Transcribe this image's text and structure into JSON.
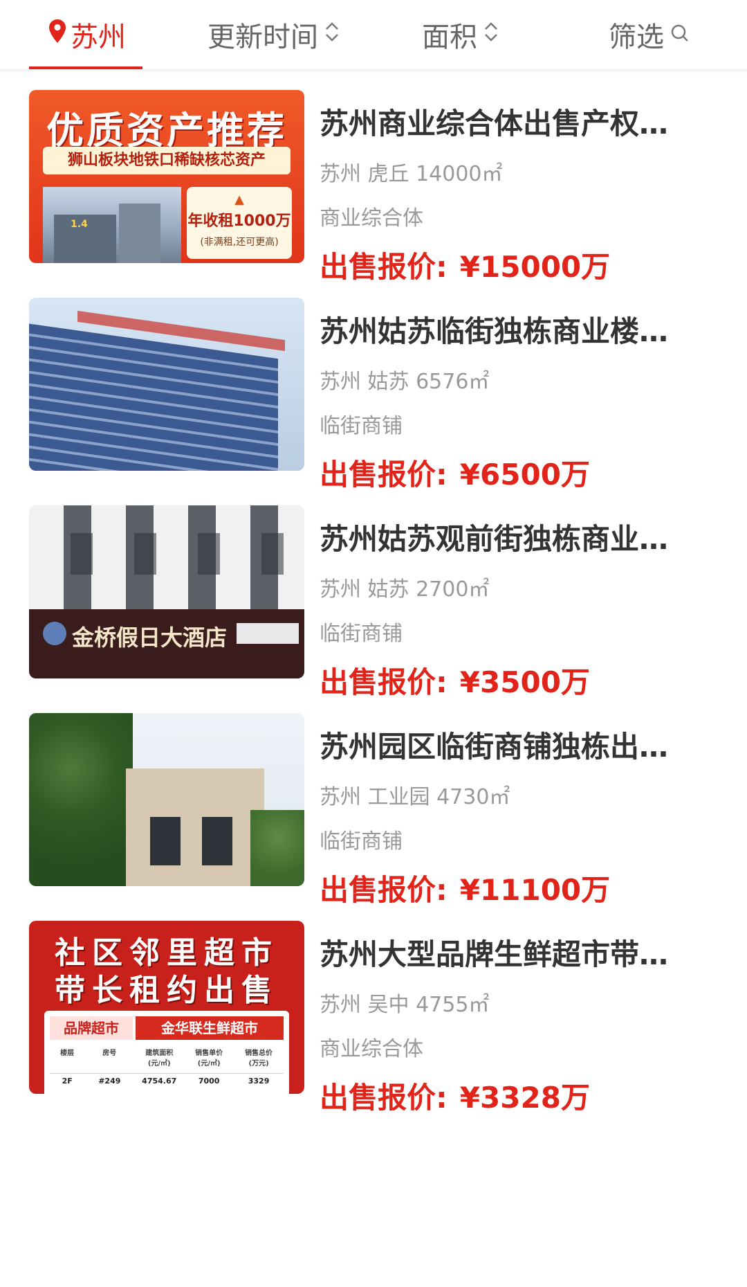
{
  "filter_bar": {
    "city": "苏州",
    "sort_updated": "更新时间",
    "sort_area": "面积",
    "filter": "筛选"
  },
  "colors": {
    "accent": "#e22319",
    "text_primary": "#333333",
    "text_secondary": "#999999"
  },
  "icons": {
    "city": "location-pin-icon",
    "sort": "sort-updown-icon",
    "filter": "search-icon"
  },
  "listings": [
    {
      "title": "苏州商业综合体出售产权…",
      "meta": "苏州 虎丘 14000㎡",
      "type": "商业综合体",
      "price_label": "出售报价:",
      "price_value": "¥15000万",
      "thumb": {
        "headline": "优质资产推荐",
        "subline": "狮山板块地铁口稀缺核芯资产",
        "tag": "1.4",
        "rent_title": "年收租1000万",
        "rent_note": "(非满租,还可更高)"
      }
    },
    {
      "title": "苏州姑苏临街独栋商业楼…",
      "meta": "苏州 姑苏 6576㎡",
      "type": "临街商铺",
      "price_label": "出售报价:",
      "price_value": "¥6500万",
      "thumb": {}
    },
    {
      "title": "苏州姑苏观前街独栋商业…",
      "meta": "苏州 姑苏 2700㎡",
      "type": "临街商铺",
      "price_label": "出售报价:",
      "price_value": "¥3500万",
      "thumb": {
        "sign": "金桥假日大酒店"
      }
    },
    {
      "title": "苏州园区临街商铺独栋出…",
      "meta": "苏州 工业园 4730㎡",
      "type": "临街商铺",
      "price_label": "出售报价:",
      "price_value": "¥11100万",
      "thumb": {}
    },
    {
      "title": "苏州大型品牌生鲜超市带…",
      "meta": "苏州 吴中 4755㎡",
      "type": "商业综合体",
      "price_label": "出售报价:",
      "price_value": "¥3328万",
      "thumb": {
        "line1": "社区邻里超市",
        "line2": "带长租约出售",
        "brand_label": "品牌超市",
        "brand_name": "金华联生鲜超市",
        "table_headers": [
          "楼层",
          "房号",
          "建筑面积\n(元/㎡)",
          "销售单价\n(元/㎡)",
          "销售总价\n(万元)"
        ],
        "table_row": [
          "2F",
          "#249",
          "4754.67",
          "7000",
          "3329"
        ]
      }
    }
  ]
}
